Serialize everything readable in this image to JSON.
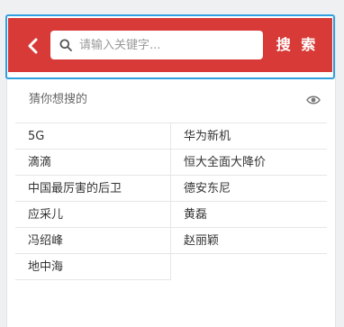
{
  "header": {
    "back_icon": "chevron-left-icon",
    "search_icon": "search-icon",
    "placeholder": "请输入关键字...",
    "search_button": "搜 索",
    "accent_color": "#d83b37"
  },
  "hints": {
    "title": "猜你想搜的",
    "toggle_icon": "eye-icon",
    "items": [
      "5G",
      "华为新机",
      "滴滴",
      "恒大全面大降价",
      "中国最厉害的后卫",
      "德安东尼",
      "应采儿",
      "黄磊",
      "冯绍峰",
      "赵丽颖",
      "地中海"
    ]
  }
}
